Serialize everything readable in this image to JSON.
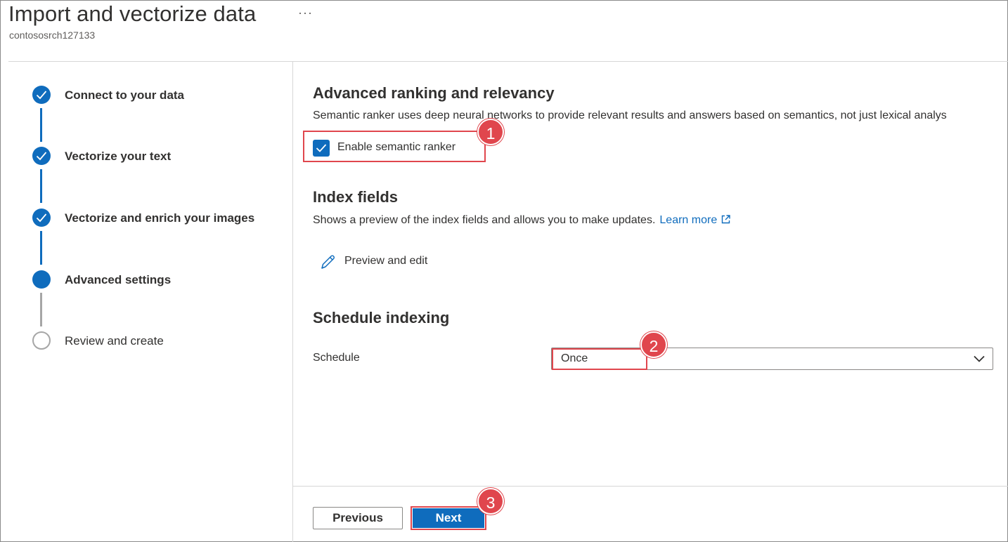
{
  "header": {
    "title": "Import and vectorize data",
    "more_icon": "ellipsis-icon",
    "more_text": "···",
    "subtitle": "contososrch127133"
  },
  "steps": [
    {
      "label": "Connect to your data",
      "state": "done"
    },
    {
      "label": "Vectorize your text",
      "state": "done"
    },
    {
      "label": "Vectorize and enrich your images",
      "state": "done"
    },
    {
      "label": "Advanced settings",
      "state": "current"
    },
    {
      "label": "Review and create",
      "state": "todo"
    }
  ],
  "ranking": {
    "title": "Advanced ranking and relevancy",
    "description": "Semantic ranker uses deep neural networks to provide relevant results and answers based on semantics, not just lexical analys",
    "checkbox_label": "Enable semantic ranker",
    "checked": true
  },
  "index_fields": {
    "title": "Index fields",
    "description": "Shows a preview of the index fields and allows you to make updates.",
    "learn_more": "Learn more",
    "edit_label": "Preview and edit"
  },
  "schedule": {
    "title": "Schedule indexing",
    "label": "Schedule",
    "value": "Once"
  },
  "footer": {
    "previous": "Previous",
    "next": "Next"
  },
  "annotations": [
    "1",
    "2",
    "3"
  ],
  "colors": {
    "accent": "#0f6cbd",
    "highlight": "#e0464d"
  }
}
